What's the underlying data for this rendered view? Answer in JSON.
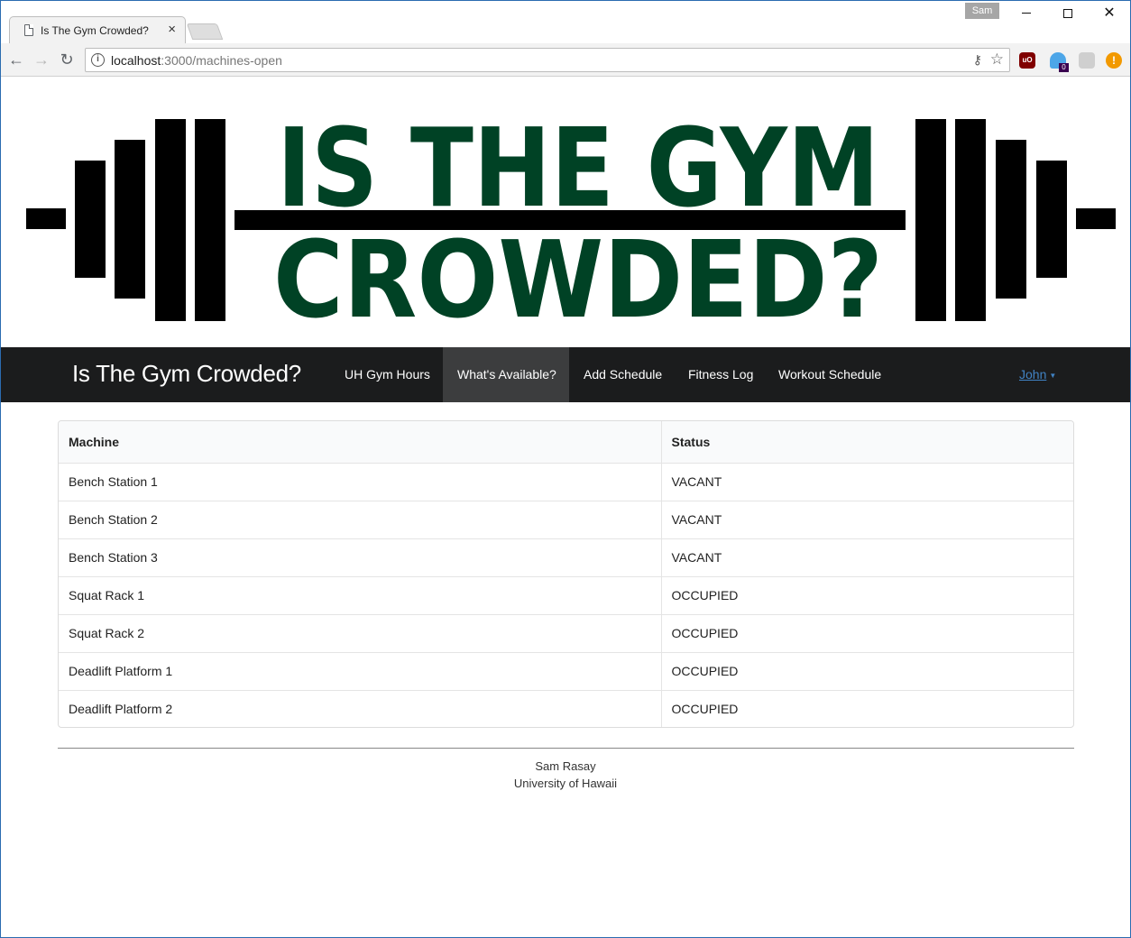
{
  "browser": {
    "tab_title": "Is The Gym Crowded?",
    "tab_close": "×",
    "profile_name": "Sam",
    "url_host": "localhost",
    "url_path": ":3000/machines-open",
    "icons": [
      "page-icon",
      "back-arrow-icon",
      "forward-arrow-icon",
      "reload-icon",
      "info-icon",
      "key-icon",
      "star-icon",
      "ublock-icon",
      "ghostery-icon",
      "chat-extension-icon",
      "warning-icon"
    ],
    "ghostery_badge": "0",
    "ublock_label": "uO",
    "warning_label": "!"
  },
  "banner": {
    "line1": "IS THE GYM",
    "line2": "CROWDED?",
    "text_color": "#004225",
    "bar_color": "#000000"
  },
  "navbar": {
    "brand": "Is The Gym Crowded?",
    "items": [
      {
        "label": "UH Gym Hours",
        "active": false
      },
      {
        "label": "What's Available?",
        "active": true
      },
      {
        "label": "Add Schedule",
        "active": false
      },
      {
        "label": "Fitness Log",
        "active": false
      },
      {
        "label": "Workout Schedule",
        "active": false
      }
    ],
    "user": "John",
    "caret": "▼",
    "background": "#1b1c1d",
    "link_color": "#4183c4"
  },
  "table": {
    "headers": {
      "machine": "Machine",
      "status": "Status"
    },
    "rows": [
      {
        "machine": "Bench Station 1",
        "status": "VACANT"
      },
      {
        "machine": "Bench Station 2",
        "status": "VACANT"
      },
      {
        "machine": "Bench Station 3",
        "status": "VACANT"
      },
      {
        "machine": "Squat Rack 1",
        "status": "OCCUPIED"
      },
      {
        "machine": "Squat Rack 2",
        "status": "OCCUPIED"
      },
      {
        "machine": "Deadlift Platform 1",
        "status": "OCCUPIED"
      },
      {
        "machine": "Deadlift Platform 2",
        "status": "OCCUPIED"
      }
    ]
  },
  "footer": {
    "name": "Sam Rasay",
    "org": "University of Hawaii"
  }
}
